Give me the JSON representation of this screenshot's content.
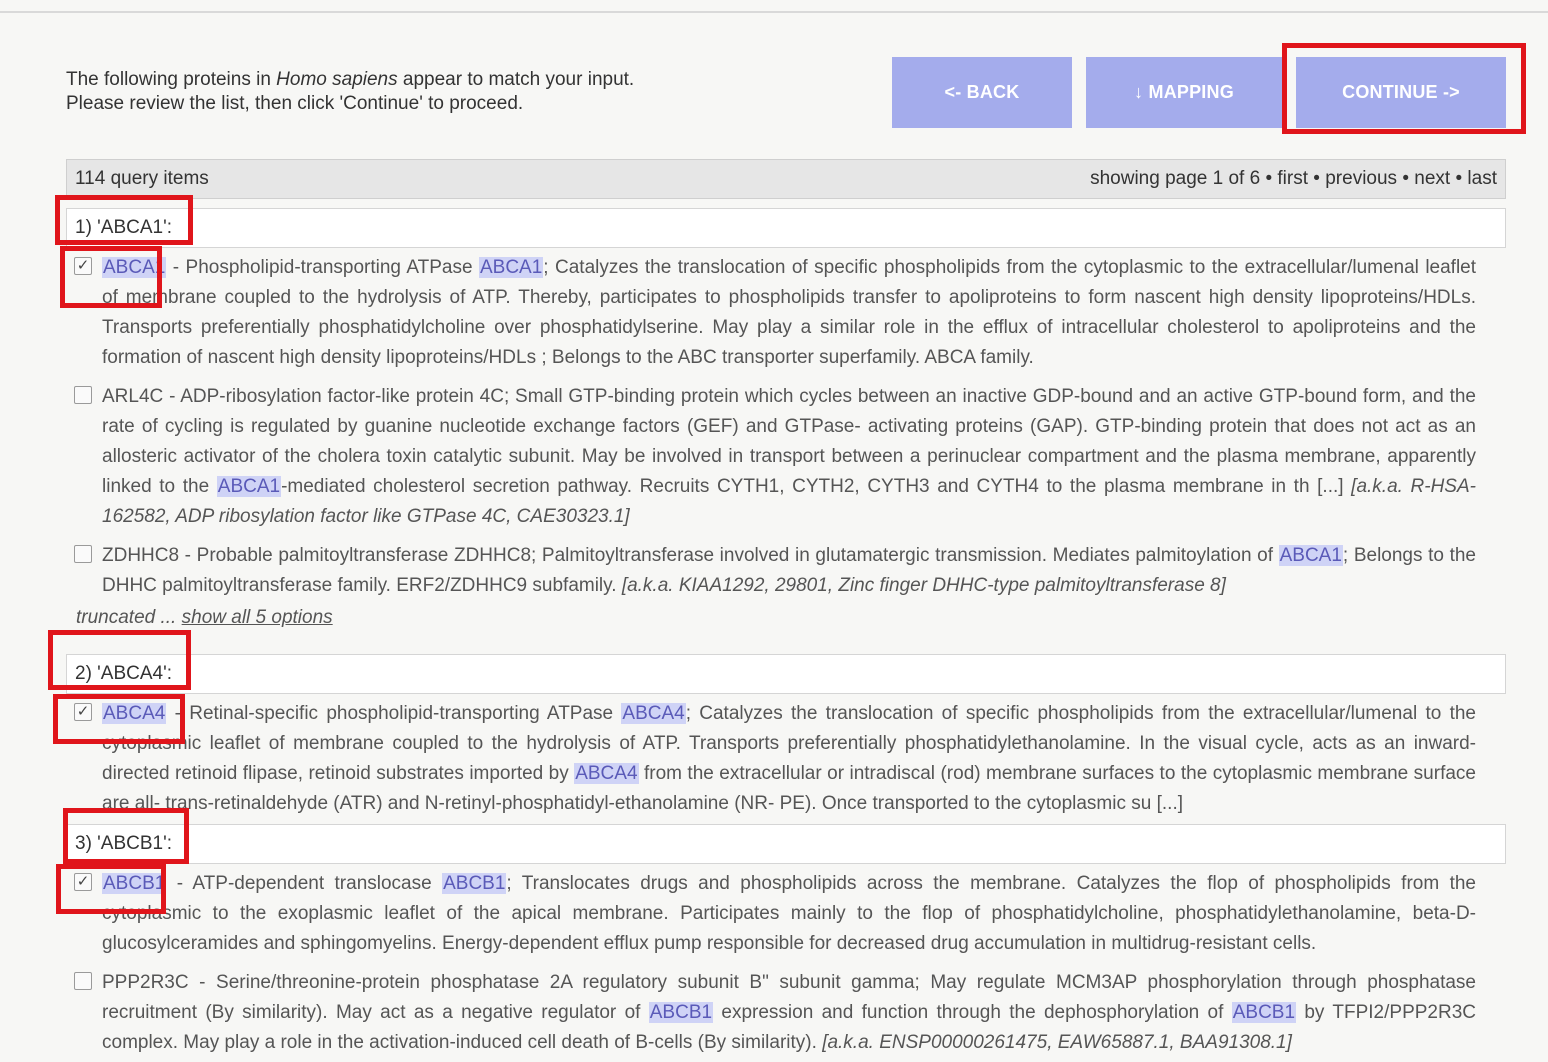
{
  "intro": {
    "line1_before": "The following proteins in ",
    "line1_species": "Homo sapiens",
    "line1_after": " appear to match your input.",
    "line2": "Please review the list, then click 'Continue' to proceed."
  },
  "buttons": {
    "back": "<- BACK",
    "mapping": "↓ MAPPING",
    "continue": "CONTINUE ->"
  },
  "pager": {
    "count": "114 query items",
    "status": "showing page 1 of 6",
    "sep": " • ",
    "first": "first",
    "previous": "previous",
    "next": "next",
    "last": "last"
  },
  "queries": [
    {
      "label": "1) 'ABCA1':",
      "options": [
        {
          "checked": true,
          "name": "ABCA1",
          "text_parts": [
            "Phospholipid-transporting ATPase ",
            "ABCA1",
            "; Catalyzes the translocation of specific phospholipids from the cytoplasmic to the extracellular/lumenal leaflet of membrane coupled to the hydrolysis of ATP. Thereby, participates to phospholipids transfer to apoliproteins to form nascent high density lipoproteins/HDLs. Transports preferentially phosphatidylcholine over phosphatidylserine. May play a similar role in the efflux of intracellular cholesterol to apoliproteins and the formation of nascent high density lipoproteins/HDLs ; Belongs to the ABC transporter superfamily. ABCA family."
          ],
          "aka": ""
        },
        {
          "checked": false,
          "name": "ARL4C",
          "text_parts": [
            "ADP-ribosylation factor-like protein 4C; Small GTP-binding protein which cycles between an inactive GDP-bound and an active GTP-bound form, and the rate of cycling is regulated by guanine nucleotide exchange factors (GEF) and GTPase- activating proteins (GAP). GTP-binding protein that does not act as an allosteric activator of the cholera toxin catalytic subunit. May be involved in transport between a perinuclear compartment and the plasma membrane, apparently linked to the ",
            "ABCA1",
            "-mediated cholesterol secretion pathway. Recruits CYTH1, CYTH2, CYTH3 and CYTH4 to the plasma membrane in th [...]"
          ],
          "aka": "[a.k.a. R-HSA-162582, ADP ribosylation factor like GTPase 4C, CAE30323.1]"
        },
        {
          "checked": false,
          "name": "ZDHHC8",
          "text_parts": [
            "Probable palmitoyltransferase ZDHHC8; Palmitoyltransferase involved in glutamatergic transmission. Mediates palmitoylation of ",
            "ABCA1",
            "; Belongs to the DHHC palmitoyltransferase family. ERF2/ZDHHC9 subfamily."
          ],
          "aka": "[a.k.a. KIAA1292, 29801, Zinc finger DHHC-type palmitoyltransferase 8]"
        }
      ],
      "truncated": "truncated ...",
      "show_all": "show all 5 options"
    },
    {
      "label": "2) 'ABCA4':",
      "options": [
        {
          "checked": true,
          "name": "ABCA4",
          "text_parts": [
            "Retinal-specific phospholipid-transporting ATPase ",
            "ABCA4",
            "; Catalyzes the translocation of specific phospholipids from the extracellular/lumenal to the cytoplasmic leaflet of membrane coupled to the hydrolysis of ATP. Transports preferentially phosphatidylethanolamine. In the visual cycle, acts as an inward-directed retinoid flipase, retinoid substrates imported by ",
            "ABCA4",
            " from the extracellular or intradiscal (rod) membrane surfaces to the cytoplasmic membrane surface are all- trans-retinaldehyde (ATR) and N-retinyl-phosphatidyl-ethanolamine (NR- PE). Once transported to the cytoplasmic su [...]"
          ],
          "aka": ""
        }
      ]
    },
    {
      "label": "3) 'ABCB1':",
      "options": [
        {
          "checked": true,
          "name": "ABCB1",
          "text_parts": [
            "ATP-dependent translocase ",
            "ABCB1",
            "; Translocates drugs and phospholipids across the membrane. Catalyzes the flop of phospholipids from the cytoplasmic to the exoplasmic leaflet of the apical membrane. Participates mainly to the flop of phosphatidylcholine, phosphatidylethanolamine, beta-D-glucosylceramides and sphingomyelins. Energy-dependent efflux pump responsible for decreased drug accumulation in multidrug-resistant cells."
          ],
          "aka": ""
        },
        {
          "checked": false,
          "name": "PPP2R3C",
          "text_parts": [
            "Serine/threonine-protein phosphatase 2A regulatory subunit B\" subunit gamma; May regulate MCM3AP phosphorylation through phosphatase recruitment (By similarity). May act as a negative regulator of ",
            "ABCB1",
            " expression and function through the dephosphorylation of ",
            "ABCB1",
            " by TFPI2/PPP2R3C complex. May play a role in the activation-induced cell death of B-cells (By similarity)."
          ],
          "aka": "[a.k.a. ENSP00000261475, EAW65887.1, BAA91308.1]"
        }
      ]
    }
  ],
  "colors": {
    "button": "#a4acec",
    "highlight": "#cfd3f6",
    "annotation_red": "#e0151b"
  }
}
